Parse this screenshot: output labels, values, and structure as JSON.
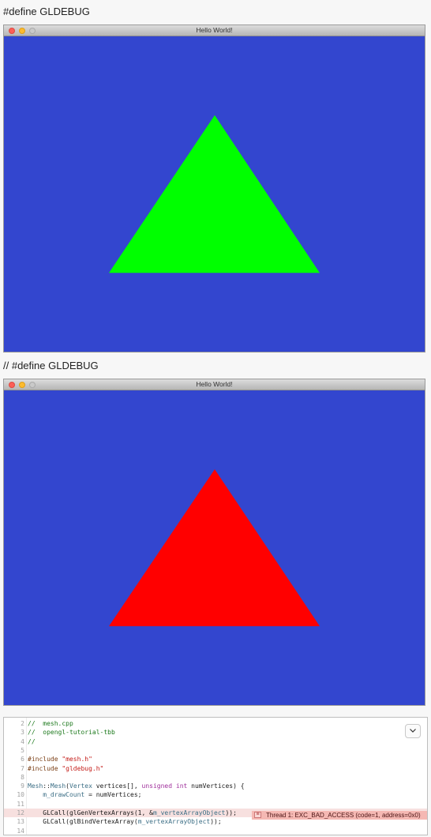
{
  "sections": [
    {
      "heading": "#define GLDEBUG",
      "window_title": "Hello World!",
      "clear_color": "#3346cf",
      "triangle_color": "#00ff00"
    },
    {
      "heading": "// #define GLDEBUG",
      "window_title": "Hello World!",
      "clear_color": "#3346cf",
      "triangle_color": "#ff0000"
    }
  ],
  "editor": {
    "error_icon": "error-icon",
    "error_text": "Thread 1: EXC_BAD_ACCESS (code=1, address=0x0)",
    "jump_icon": "chevron-down-icon",
    "lines": [
      {
        "num": "2",
        "tokens": [
          {
            "t": "//  mesh.cpp",
            "c": "cmt"
          }
        ]
      },
      {
        "num": "3",
        "tokens": [
          {
            "t": "//  opengl-tutorial-tbb",
            "c": "cmt"
          }
        ]
      },
      {
        "num": "4",
        "tokens": [
          {
            "t": "//",
            "c": "cmt"
          }
        ]
      },
      {
        "num": "5",
        "tokens": []
      },
      {
        "num": "6",
        "tokens": [
          {
            "t": "#include ",
            "c": "pre"
          },
          {
            "t": "\"mesh.h\"",
            "c": "str"
          }
        ]
      },
      {
        "num": "7",
        "tokens": [
          {
            "t": "#include ",
            "c": "pre"
          },
          {
            "t": "\"gldebug.h\"",
            "c": "str"
          }
        ]
      },
      {
        "num": "8",
        "tokens": []
      },
      {
        "num": "9",
        "tokens": [
          {
            "t": "Mesh",
            "c": "typ"
          },
          {
            "t": "::",
            "c": ""
          },
          {
            "t": "Mesh",
            "c": "typ"
          },
          {
            "t": "(",
            "c": ""
          },
          {
            "t": "Vertex",
            "c": "typ"
          },
          {
            "t": " vertices[], ",
            "c": ""
          },
          {
            "t": "unsigned int",
            "c": "kw"
          },
          {
            "t": " numVertices) {",
            "c": ""
          }
        ]
      },
      {
        "num": "10",
        "tokens": [
          {
            "t": "    ",
            "c": ""
          },
          {
            "t": "m_drawCount",
            "c": "mem"
          },
          {
            "t": " = numVertices;",
            "c": ""
          }
        ]
      },
      {
        "num": "11",
        "tokens": []
      },
      {
        "num": "12",
        "tokens": [
          {
            "t": "    GLCall(glGenVertexArrays(1, &",
            "c": ""
          },
          {
            "t": "m_vertexArrayObject",
            "c": "mem"
          },
          {
            "t": "));",
            "c": ""
          }
        ],
        "highlight": true
      },
      {
        "num": "13",
        "tokens": [
          {
            "t": "    GLCall(glBindVertexArray(",
            "c": ""
          },
          {
            "t": "m_vertexArrayObject",
            "c": "mem"
          },
          {
            "t": "));",
            "c": ""
          }
        ]
      },
      {
        "num": "14",
        "tokens": []
      }
    ]
  }
}
